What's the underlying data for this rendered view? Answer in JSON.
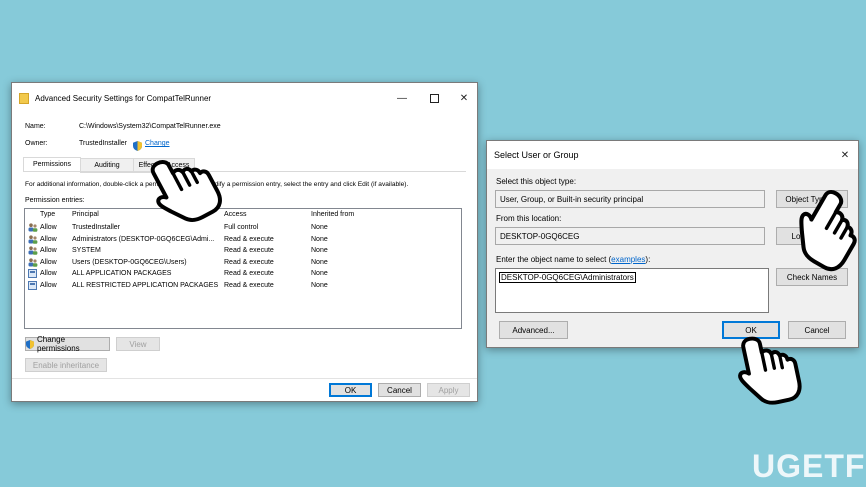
{
  "window1": {
    "title": "Advanced Security Settings for CompatTelRunner",
    "name_label": "Name:",
    "name_value": "C:\\Windows\\System32\\CompatTelRunner.exe",
    "owner_label": "Owner:",
    "owner_value": "TrustedInstaller",
    "change_link": "Change",
    "tabs": [
      {
        "label": "Permissions"
      },
      {
        "label": "Auditing"
      },
      {
        "label": "Effective Access"
      }
    ],
    "info_text": "For additional information, double-click a permission entry. To modify a permission entry, select the entry and click Edit (if available).",
    "entries_label": "Permission entries:",
    "columns": [
      "Type",
      "Principal",
      "Access",
      "Inherited from"
    ],
    "rows": [
      {
        "icon": "user-group-icon",
        "type": "Allow",
        "principal": "TrustedInstaller",
        "access": "Full control",
        "inherited": "None"
      },
      {
        "icon": "user-group-icon",
        "type": "Allow",
        "principal": "Administrators (DESKTOP-0GQ6CEG\\Admi...",
        "access": "Read & execute",
        "inherited": "None"
      },
      {
        "icon": "user-group-icon",
        "type": "Allow",
        "principal": "SYSTEM",
        "access": "Read & execute",
        "inherited": "None"
      },
      {
        "icon": "user-group-icon",
        "type": "Allow",
        "principal": "Users (DESKTOP-0GQ6CEG\\Users)",
        "access": "Read & execute",
        "inherited": "None"
      },
      {
        "icon": "package-icon",
        "type": "Allow",
        "principal": "ALL APPLICATION PACKAGES",
        "access": "Read & execute",
        "inherited": "None"
      },
      {
        "icon": "package-icon",
        "type": "Allow",
        "principal": "ALL RESTRICTED APPLICATION PACKAGES",
        "access": "Read & execute",
        "inherited": "None"
      }
    ],
    "change_permissions": "Change permissions",
    "view": "View",
    "enable_inheritance": "Enable inheritance",
    "ok": "OK",
    "cancel": "Cancel",
    "apply": "Apply"
  },
  "window2": {
    "title": "Select User or Group",
    "object_type_label": "Select this object type:",
    "object_type_value": "User, Group, or Built-in security principal",
    "object_types_button": "Object Types...",
    "location_label": "From this location:",
    "location_value": "DESKTOP-0GQ6CEG",
    "locations_button": "Locations...",
    "enter_label_prefix": "Enter the object name to select (",
    "examples_link": "examples",
    "enter_label_suffix": "):",
    "object_name_value": "DESKTOP-0GQ6CEG\\Administrators",
    "check_names": "Check Names",
    "advanced": "Advanced...",
    "ok": "OK",
    "cancel": "Cancel"
  },
  "watermark": "UGETFIX",
  "colors": {
    "background": "#86cad9",
    "link": "#0066cc",
    "accent": "#0078d7"
  }
}
